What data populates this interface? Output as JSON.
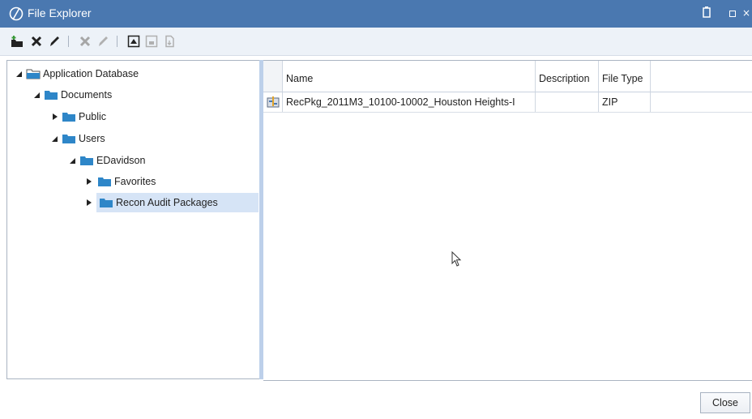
{
  "window": {
    "title": "File Explorer"
  },
  "toolbar": {
    "buttons": [
      "new-folder-icon",
      "delete-icon",
      "edit-icon",
      "delete-file-icon",
      "edit-file-icon",
      "upload-icon",
      "save-icon",
      "export-icon"
    ]
  },
  "tree": {
    "nodes": [
      {
        "label": "Application Database",
        "icon": "database-folder-icon"
      },
      {
        "label": "Documents",
        "icon": "folder-icon"
      },
      {
        "label": "Public",
        "icon": "folder-icon"
      },
      {
        "label": "Users",
        "icon": "folder-icon"
      },
      {
        "label": "EDavidson",
        "icon": "folder-icon"
      },
      {
        "label": "Favorites",
        "icon": "folder-icon"
      },
      {
        "label": "Recon Audit Packages",
        "icon": "folder-icon",
        "selected": true
      }
    ]
  },
  "grid": {
    "columns": [
      "Name",
      "Description",
      "File Type"
    ],
    "rows": [
      {
        "icon": "zip-file-icon",
        "name": "RecPkg_2011M3_10100-10002_Houston Heights-I",
        "description": "",
        "file_type": "ZIP"
      }
    ]
  },
  "footer": {
    "close_label": "Close"
  },
  "colors": {
    "titlebar": "#4a78b0",
    "toolbar": "#edf2f8",
    "selection": "#d6e4f6",
    "folder": "#2e86c8"
  }
}
